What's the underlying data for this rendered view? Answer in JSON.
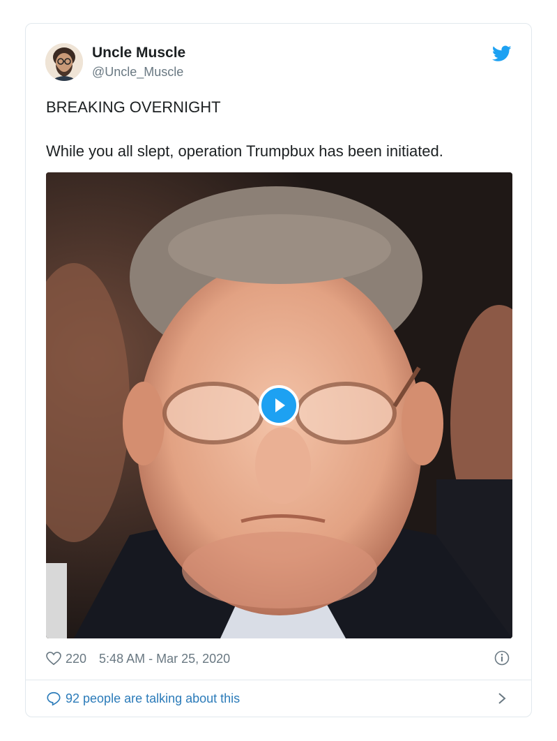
{
  "tweet": {
    "author_name": "Uncle Muscle",
    "author_handle": "@Uncle_Muscle",
    "text_line1": "BREAKING OVERNIGHT",
    "text_line2": "While you all slept, operation Trumpbux has been initiated.",
    "likes": "220",
    "timestamp": "5:48 AM - Mar 25, 2020",
    "conversation": "92 people are talking about this"
  },
  "icons": {
    "brand": "twitter-bird-icon",
    "play": "play-icon",
    "like": "heart-icon",
    "info": "info-icon",
    "reply": "speech-bubble-icon",
    "next": "chevron-right-icon"
  },
  "colors": {
    "brand_blue": "#1da1f2",
    "link_blue": "#2b7bb9",
    "muted_text": "#697882",
    "border": "#e1e8ed"
  }
}
